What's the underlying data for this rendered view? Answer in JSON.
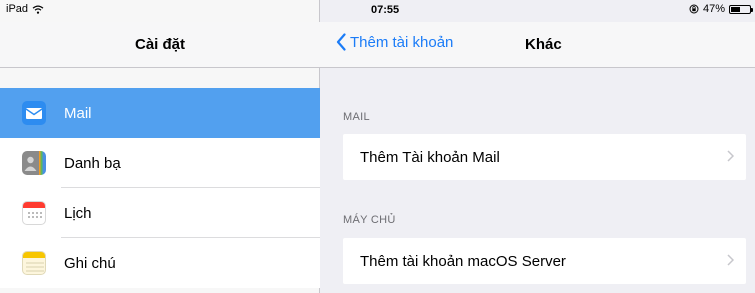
{
  "status_bar": {
    "device": "iPad",
    "time": "07:55",
    "battery": "47%"
  },
  "master": {
    "title": "Cài đặt",
    "items": [
      {
        "label": "Mail",
        "icon": "mail-icon",
        "selected": true
      },
      {
        "label": "Danh bạ",
        "icon": "contacts-icon",
        "selected": false
      },
      {
        "label": "Lịch",
        "icon": "calendar-icon",
        "selected": false
      },
      {
        "label": "Ghi chú",
        "icon": "notes-icon",
        "selected": false
      }
    ]
  },
  "detail": {
    "back_label": "Thêm tài khoản",
    "title": "Khác",
    "sections": [
      {
        "header": "MAIL",
        "row": "Thêm Tài khoản Mail"
      },
      {
        "header": "MÁY CHỦ",
        "row": "Thêm tài khoản macOS Server"
      }
    ]
  },
  "colors": {
    "accent": "#1b7cf7",
    "selected_row": "#52a0ef",
    "background": "#efeff4"
  }
}
